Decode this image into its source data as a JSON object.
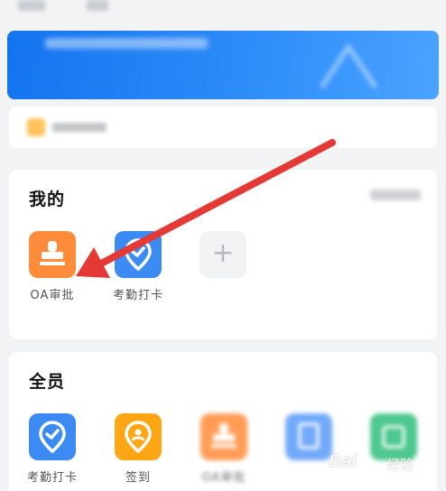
{
  "colors": {
    "page_bg": "#f2f3f5",
    "banner_blue": "#1677ff",
    "oa_orange": "#ff8c3a",
    "attendance_blue": "#3c8bf5",
    "signin_yellow": "#ffa614",
    "doc_blue": "#5a9cf8",
    "green": "#2fbf7b",
    "arrow_red": "#e53935"
  },
  "mine": {
    "title": "我的",
    "apps": [
      {
        "label": "OA审批",
        "icon": "stamp-icon"
      },
      {
        "label": "考勤打卡",
        "icon": "location-check-icon"
      }
    ],
    "add_icon": "plus-icon"
  },
  "all": {
    "title": "全员",
    "apps": [
      {
        "label": "考勤打卡",
        "icon": "location-check-icon"
      },
      {
        "label": "签到",
        "icon": "location-person-icon"
      },
      {
        "label": "OA审批",
        "icon": "stamp-icon"
      }
    ]
  },
  "watermark": {
    "brand": "Bai",
    "sub": "经验"
  }
}
